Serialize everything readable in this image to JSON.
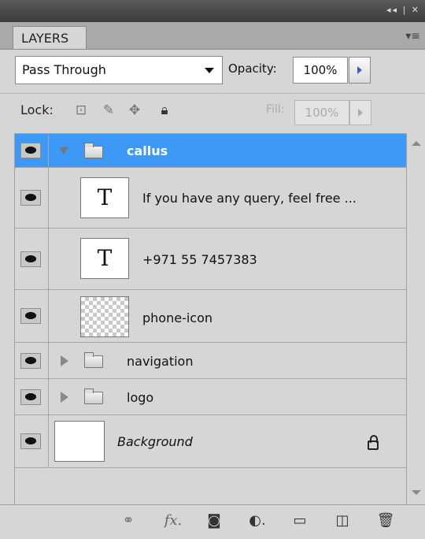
{
  "panel": {
    "tab_label": "LAYERS",
    "window_controls": "◂◂ | ✕",
    "menu_icon": "panel-menu-icon"
  },
  "blend": {
    "mode": "Pass Through",
    "opacity_label": "Opacity:",
    "opacity_value": "100%"
  },
  "lock": {
    "label": "Lock:",
    "fill_label": "Fill:",
    "fill_value": "100%"
  },
  "layers": [
    {
      "name": "callus",
      "type": "group",
      "expanded": true,
      "selected": true
    },
    {
      "name": "If you have any query, feel free ...",
      "type": "text",
      "thumb": "T"
    },
    {
      "name": "+971 55 7457383",
      "type": "text",
      "thumb": "T"
    },
    {
      "name": "phone-icon",
      "type": "image"
    },
    {
      "name": "navigation",
      "type": "group",
      "expanded": false
    },
    {
      "name": "logo",
      "type": "group",
      "expanded": false
    },
    {
      "name": "Background",
      "type": "background",
      "locked": true
    }
  ],
  "colors": {
    "selection": "#3d99f5",
    "panel_bg": "#d6d6d6"
  }
}
